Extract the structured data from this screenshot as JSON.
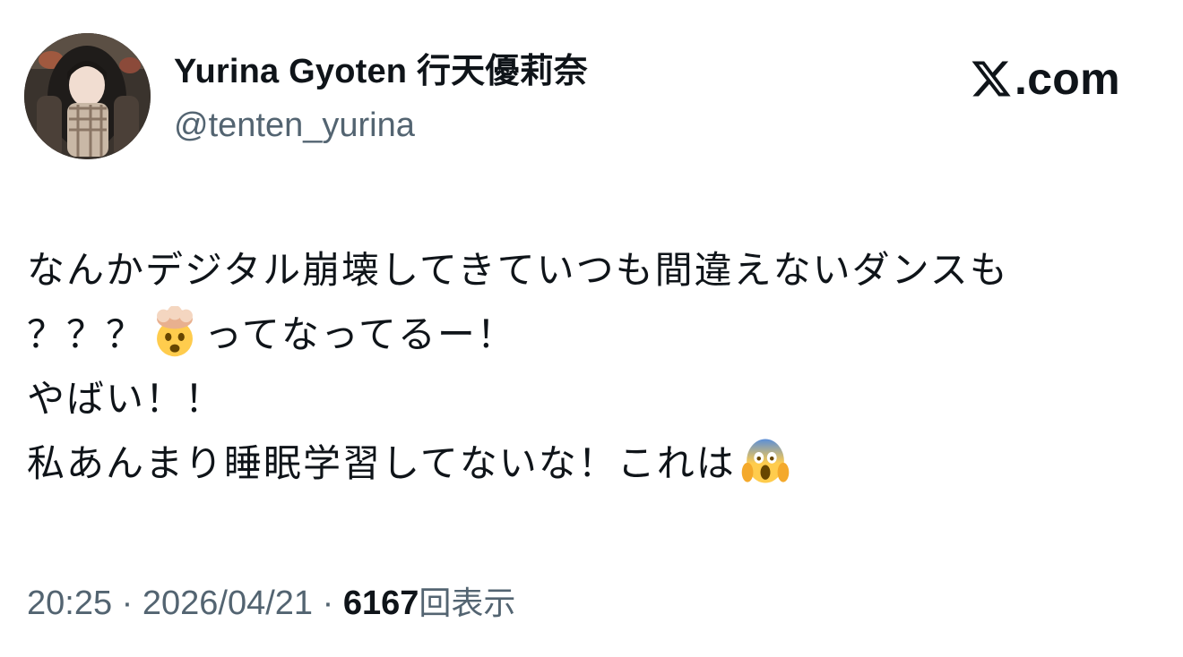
{
  "author": {
    "display_name": "Yurina Gyoten 行天優莉奈",
    "handle": "@tenten_yurina"
  },
  "brand": {
    "icon": "x-logo-icon",
    "text": ".com"
  },
  "tweet": {
    "line1": "なんかデジタル崩壊してきていつも間違えないダンスも",
    "line2_before": "？？？",
    "line2_emoji": "exploding-head-icon",
    "line2_after": "ってなってるー！",
    "line3": "やばい！！",
    "line4_before": "私あんまり睡眠学習してないな！これは",
    "line4_emoji": "screaming-face-icon"
  },
  "meta": {
    "time": "20:25",
    "separator": " · ",
    "date": "2026/04/21",
    "views_count": "6167",
    "views_label": "回表示"
  }
}
